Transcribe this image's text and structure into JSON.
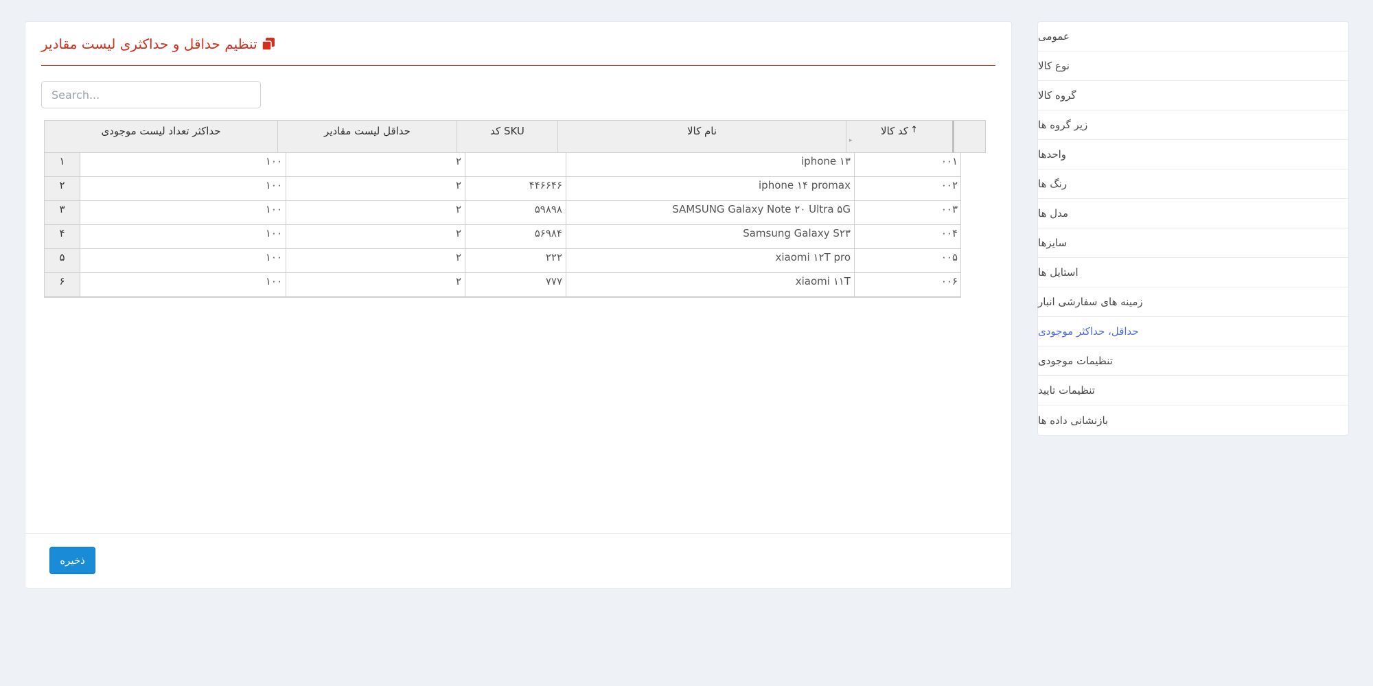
{
  "sidebar": {
    "items": [
      {
        "label": "عمومی"
      },
      {
        "label": "نوع کالا"
      },
      {
        "label": "گروه کالا"
      },
      {
        "label": "زیر گروه ها"
      },
      {
        "label": "واحدها"
      },
      {
        "label": "رنگ ها"
      },
      {
        "label": "مدل ها"
      },
      {
        "label": "سایزها"
      },
      {
        "label": "استایل ها"
      },
      {
        "label": "زمینه های سفارشی انبار"
      },
      {
        "label": "حداقل، حداکثر موجودی",
        "active": true
      },
      {
        "label": "تنظیمات موجودی"
      },
      {
        "label": "تنظیمات تایید"
      },
      {
        "label": "بازنشانی داده ها"
      }
    ]
  },
  "page": {
    "title": "تنظیم حداقل و حداکثری لیست مقادیر",
    "title_icon": "clone-icon"
  },
  "search": {
    "placeholder": "Search..."
  },
  "grid": {
    "headers": {
      "code": "کد کالا",
      "name": "نام کالا",
      "sku": "SKU کد",
      "min": "حداقل لیست مقادیر",
      "max": "حداکثر تعداد لیست موجودی"
    },
    "sort_indicator": "↑",
    "rows": [
      {
        "code": "۰۰۱",
        "name": "iphone ۱۳",
        "sku": "",
        "min": "۲",
        "max": "۱۰۰",
        "num": "۱"
      },
      {
        "code": "۰۰۲",
        "name": "iphone ۱۴ promax",
        "sku": "۴۴۶۶۴۶",
        "min": "۲",
        "max": "۱۰۰",
        "num": "۲"
      },
      {
        "code": "۰۰۳",
        "name": "SAMSUNG Galaxy Note ۲۰ Ultra ۵G",
        "sku": "۵۹۸۹۸",
        "min": "۲",
        "max": "۱۰۰",
        "num": "۳"
      },
      {
        "code": "۰۰۴",
        "name": "Samsung Galaxy S۲۳",
        "sku": "۵۶۹۸۴",
        "min": "۲",
        "max": "۱۰۰",
        "num": "۴"
      },
      {
        "code": "۰۰۵",
        "name": "xiaomi ۱۲T pro",
        "sku": "۲۲۲",
        "min": "۲",
        "max": "۱۰۰",
        "num": "۵"
      },
      {
        "code": "۰۰۶",
        "name": "xiaomi ۱۱T",
        "sku": "۷۷۷",
        "min": "۲",
        "max": "۱۰۰",
        "num": "۶"
      }
    ]
  },
  "footer": {
    "save_label": "ذخیره"
  },
  "colors": {
    "accent_red": "#d22f1e",
    "primary_blue": "#1a8bd6",
    "active_link": "#4f6bd8"
  }
}
